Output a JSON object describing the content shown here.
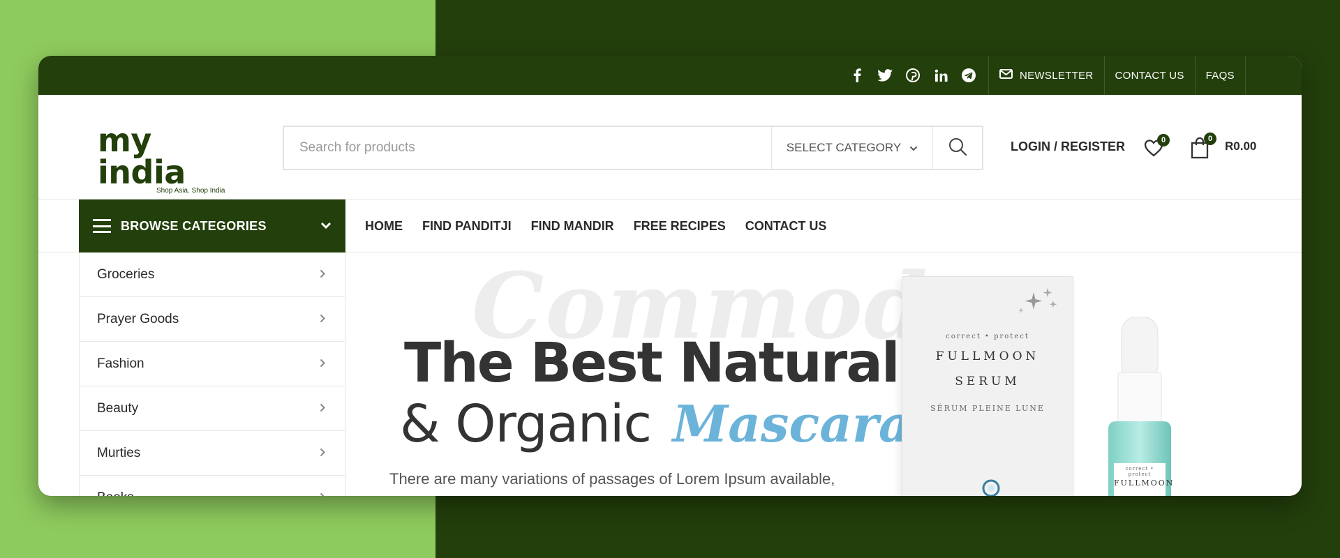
{
  "topbar": {
    "social_icons": [
      "facebook-icon",
      "twitter-icon",
      "pinterest-icon",
      "linkedin-icon",
      "telegram-icon"
    ],
    "links": [
      {
        "label": "NEWSLETTER",
        "icon": "mail-icon"
      },
      {
        "label": "CONTACT US"
      },
      {
        "label": "FAQS"
      }
    ]
  },
  "header": {
    "logo_text": "my india",
    "logo_tagline": "Shop Asia. Shop India",
    "search_placeholder": "Search for products",
    "category_label": "SELECT CATEGORY",
    "login_label": "LOGIN / REGISTER",
    "wishlist_count": "0",
    "cart_count": "0",
    "cart_total": "R0.00"
  },
  "nav": {
    "browse_label": "BROWSE CATEGORIES",
    "menu": [
      "HOME",
      "FIND PANDITJI",
      "FIND MANDIR",
      "FREE RECIPES",
      "CONTACT US"
    ]
  },
  "categories": [
    "Groceries",
    "Prayer Goods",
    "Fashion",
    "Beauty",
    "Murties",
    "Books"
  ],
  "hero": {
    "script_bg": "Commodo",
    "title": "The Best Natural",
    "subtitle": "& Organic",
    "accent": "Mascara.",
    "description": "There are many variations of passages of Lorem Ipsum available,",
    "product": {
      "box_tagline": "correct • protect",
      "box_name_1": "FULLMOON",
      "box_name_2": "SERUM",
      "box_sub": "SÉRUM PLEINE LUNE",
      "bottle_tagline": "correct • protect",
      "bottle_name": "FULLMOON"
    }
  },
  "colors": {
    "brand": "#233f0b",
    "accent_light": "#8ecb5e",
    "hero_accent": "#6cb3d9"
  }
}
